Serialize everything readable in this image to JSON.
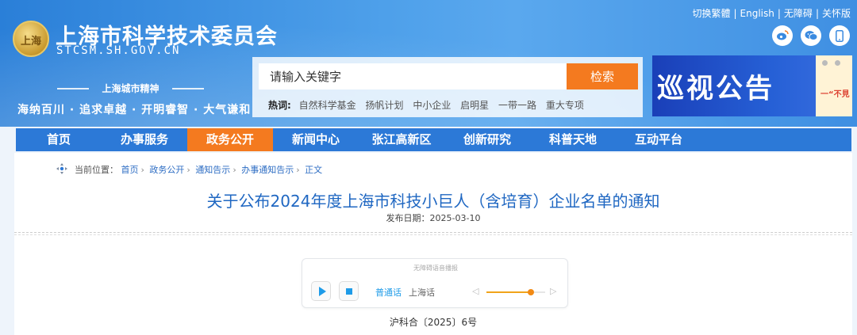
{
  "header": {
    "title": "上海市科学技术委员会",
    "domain": "STCSM.SH.GOV.CN",
    "emblem_text": "上海",
    "spirit_title": "上海城市精神",
    "spirit_text": "海纳百川 · 追求卓越 · 开明睿智 · 大气谦和",
    "top_links": [
      "切换繁體",
      "English",
      "无障碍",
      "关怀版"
    ],
    "social": [
      {
        "name": "weibo-icon",
        "glyph": "微"
      },
      {
        "name": "wechat-icon",
        "glyph": "信"
      },
      {
        "name": "mobile-icon",
        "glyph": "▯"
      }
    ]
  },
  "search": {
    "placeholder": "请输入关键字",
    "button": "检索",
    "hot_label": "热词:",
    "hot_words": [
      "自然科学基金",
      "扬帆计划",
      "中小企业",
      "启明星",
      "一带一路",
      "重大专项"
    ]
  },
  "banner": {
    "text": "巡视公告",
    "side_text": "一“不見"
  },
  "nav": {
    "items": [
      "首页",
      "办事服务",
      "政务公开",
      "新闻中心",
      "张江高新区",
      "创新研究",
      "科普天地",
      "互动平台"
    ],
    "active_index": 2
  },
  "breadcrumb": {
    "label": "当前位置：",
    "items": [
      "首页",
      "政务公开",
      "通知告示",
      "办事通知告示",
      "正文"
    ]
  },
  "article": {
    "title": "关于公布2024年度上海市科技小巨人（含培育）企业名单的通知",
    "date_label": "发布日期：",
    "date": "2025-03-10",
    "doc_no": "沪科合〔2025〕6号"
  },
  "player": {
    "caption": "无障碍语音播报",
    "lang_mandarin": "普通话",
    "lang_shanghai": "上海话",
    "volume": 0.75
  },
  "colors": {
    "brand_blue": "#2c79d7",
    "accent_orange": "#f47a1f",
    "title_blue": "#1f67c2"
  }
}
